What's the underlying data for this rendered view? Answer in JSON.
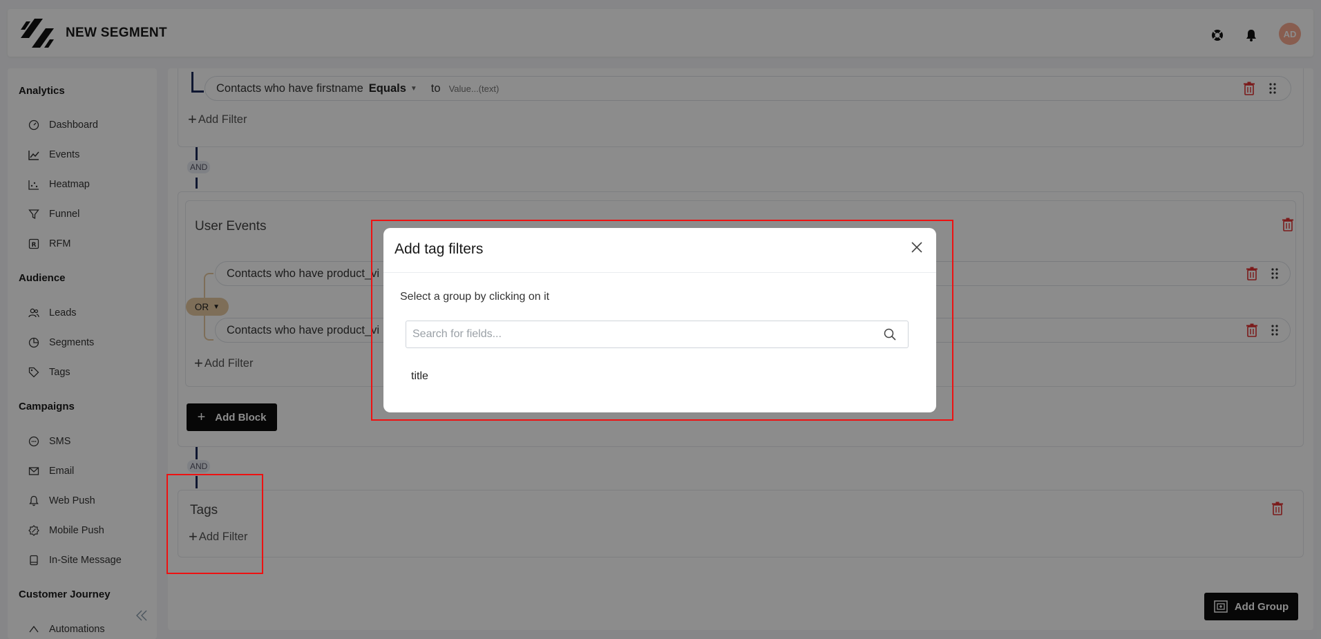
{
  "header": {
    "title": "NEW SEGMENT",
    "avatar_initials": "AD"
  },
  "sidebar": {
    "sections": [
      {
        "label": "Analytics",
        "items": [
          "Dashboard",
          "Events",
          "Heatmap",
          "Funnel",
          "RFM"
        ]
      },
      {
        "label": "Audience",
        "items": [
          "Leads",
          "Segments",
          "Tags"
        ]
      },
      {
        "label": "Campaigns",
        "items": [
          "SMS",
          "Email",
          "Web Push",
          "Mobile Push",
          "In-Site Message"
        ]
      },
      {
        "label": "Customer Journey",
        "items": [
          "Automations"
        ]
      }
    ]
  },
  "main": {
    "block1": {
      "row1": {
        "prefix": "Contacts who have firstname",
        "operator": "Equals",
        "to": "to",
        "value_placeholder": "Value...(text)"
      },
      "add_filter": "Add Filter"
    },
    "and_label": "AND",
    "block2": {
      "title": "User Events",
      "row1": "Contacts who have product_vi",
      "row2": "Contacts who have product_vi",
      "or_label": "OR",
      "add_filter": "Add Filter",
      "add_block": "Add Block"
    },
    "block3": {
      "title": "Tags",
      "add_filter": "Add Filter"
    },
    "add_group": "Add Group"
  },
  "modal": {
    "title": "Add tag filters",
    "subtitle": "Select a group by clicking on it",
    "search_placeholder": "Search for fields...",
    "results": [
      "title"
    ]
  },
  "colors": {
    "accent": "#0d0d0d",
    "danger": "#e03131",
    "avatar": "#f7a991",
    "highlight": "#e11111",
    "or_badge": "#e6c9a0"
  }
}
